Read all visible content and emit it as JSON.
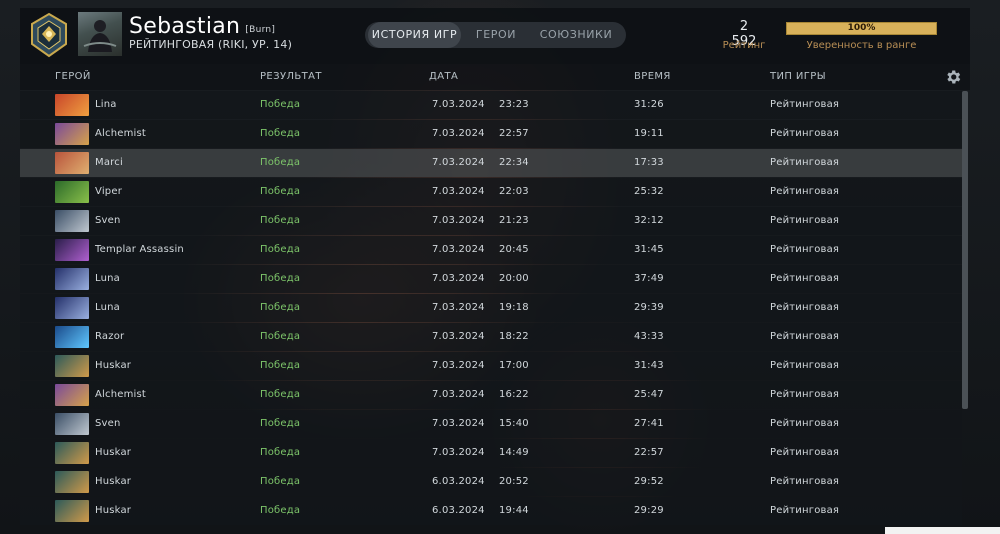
{
  "header": {
    "medal_text": "Rank medal",
    "player_name": "Sebastian",
    "player_tag": "[Burn]",
    "player_sub": "РЕЙТИНГОВАЯ (RIKI, УР. 14)",
    "tabs": [
      "ИСТОРИЯ ИГР",
      "ГЕРОИ",
      "СОЮЗНИКИ"
    ],
    "active_tab": 0,
    "rating_value": "2 592",
    "rating_label": "Рейтинг",
    "confidence_percent": "100%",
    "confidence_fraction": 1.0,
    "confidence_label": "Уверенность в ранге"
  },
  "columns": {
    "hero": "ГЕРОЙ",
    "result": "РЕЗУЛЬТАТ",
    "date": "ДАТА",
    "time": "ВРЕМЯ",
    "game_type": "ТИП ИГРЫ"
  },
  "icons": {
    "settings": "gear-icon"
  },
  "colors": {
    "win": "#7dc56a",
    "accent_gold": "#d8b15a",
    "label_gold": "#b98f55"
  },
  "matches": [
    {
      "hero": "Lina",
      "result": "Победа",
      "date": "7.03.2024",
      "time": "23:23",
      "duration": "31:26",
      "type": "Рейтинговая",
      "portrait": [
        "#c8462a",
        "#f0a040"
      ]
    },
    {
      "hero": "Alchemist",
      "result": "Победа",
      "date": "7.03.2024",
      "time": "22:57",
      "duration": "19:11",
      "type": "Рейтинговая",
      "portrait": [
        "#7a4a9a",
        "#d6a24a"
      ]
    },
    {
      "hero": "Marci",
      "result": "Победа",
      "date": "7.03.2024",
      "time": "22:34",
      "duration": "17:33",
      "type": "Рейтинговая",
      "portrait": [
        "#b8543c",
        "#e0b070"
      ]
    },
    {
      "hero": "Viper",
      "result": "Победа",
      "date": "7.03.2024",
      "time": "22:03",
      "duration": "25:32",
      "type": "Рейтинговая",
      "portrait": [
        "#2c6a2a",
        "#8ac04a"
      ]
    },
    {
      "hero": "Sven",
      "result": "Победа",
      "date": "7.03.2024",
      "time": "21:23",
      "duration": "32:12",
      "type": "Рейтинговая",
      "portrait": [
        "#3a4e66",
        "#c0c8d0"
      ]
    },
    {
      "hero": "Templar Assassin",
      "result": "Победа",
      "date": "7.03.2024",
      "time": "20:45",
      "duration": "31:45",
      "type": "Рейтинговая",
      "portrait": [
        "#2a1e4a",
        "#b060d0"
      ]
    },
    {
      "hero": "Luna",
      "result": "Победа",
      "date": "7.03.2024",
      "time": "20:00",
      "duration": "37:49",
      "type": "Рейтинговая",
      "portrait": [
        "#24306a",
        "#9ab0e0"
      ]
    },
    {
      "hero": "Luna",
      "result": "Победа",
      "date": "7.03.2024",
      "time": "19:18",
      "duration": "29:39",
      "type": "Рейтинговая",
      "portrait": [
        "#24306a",
        "#9ab0e0"
      ]
    },
    {
      "hero": "Razor",
      "result": "Победа",
      "date": "7.03.2024",
      "time": "18:22",
      "duration": "43:33",
      "type": "Рейтинговая",
      "portrait": [
        "#1a4a8a",
        "#60c8ff"
      ]
    },
    {
      "hero": "Huskar",
      "result": "Победа",
      "date": "7.03.2024",
      "time": "17:00",
      "duration": "31:43",
      "type": "Рейтинговая",
      "portrait": [
        "#2c5a5a",
        "#d09a4a"
      ]
    },
    {
      "hero": "Alchemist",
      "result": "Победа",
      "date": "7.03.2024",
      "time": "16:22",
      "duration": "25:47",
      "type": "Рейтинговая",
      "portrait": [
        "#7a4a9a",
        "#d6a24a"
      ]
    },
    {
      "hero": "Sven",
      "result": "Победа",
      "date": "7.03.2024",
      "time": "15:40",
      "duration": "27:41",
      "type": "Рейтинговая",
      "portrait": [
        "#3a4e66",
        "#c0c8d0"
      ]
    },
    {
      "hero": "Huskar",
      "result": "Победа",
      "date": "7.03.2024",
      "time": "14:49",
      "duration": "22:57",
      "type": "Рейтинговая",
      "portrait": [
        "#2c5a5a",
        "#d09a4a"
      ]
    },
    {
      "hero": "Huskar",
      "result": "Победа",
      "date": "6.03.2024",
      "time": "20:52",
      "duration": "29:52",
      "type": "Рейтинговая",
      "portrait": [
        "#2c5a5a",
        "#d09a4a"
      ]
    },
    {
      "hero": "Huskar",
      "result": "Победа",
      "date": "6.03.2024",
      "time": "19:44",
      "duration": "29:29",
      "type": "Рейтинговая",
      "portrait": [
        "#2c5a5a",
        "#d09a4a"
      ]
    }
  ],
  "highlighted_row": 2
}
